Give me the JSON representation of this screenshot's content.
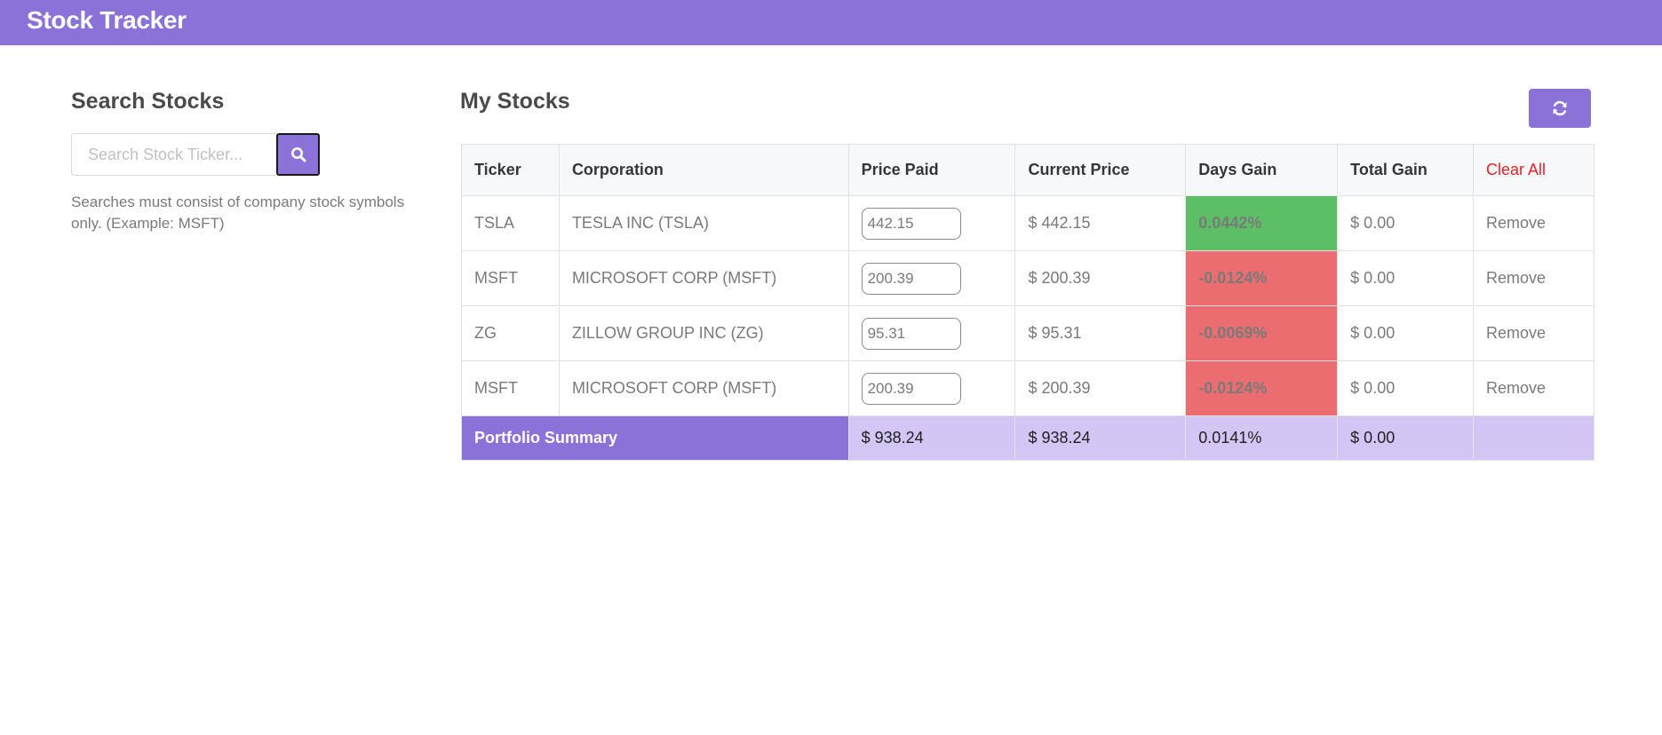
{
  "app": {
    "title": "Stock Tracker"
  },
  "search": {
    "title": "Search Stocks",
    "placeholder": "Search Stock Ticker...",
    "help": "Searches must consist of company stock symbols only. (Example: MSFT)",
    "button_icon": "search-icon"
  },
  "stocks": {
    "title": "My Stocks",
    "refresh_icon": "refresh-icon",
    "headers": {
      "ticker": "Ticker",
      "corporation": "Corporation",
      "price_paid": "Price Paid",
      "current_price": "Current Price",
      "days_gain": "Days Gain",
      "total_gain": "Total Gain",
      "clear_all": "Clear All"
    },
    "rows": [
      {
        "ticker": "TSLA",
        "corporation": "TESLA INC (TSLA)",
        "price_paid": "442.15",
        "current_price": "$ 442.15",
        "days_gain": "0.0442%",
        "days_gain_status": "positive",
        "total_gain": "$ 0.00",
        "action": "Remove"
      },
      {
        "ticker": "MSFT",
        "corporation": "MICROSOFT CORP (MSFT)",
        "price_paid": "200.39",
        "current_price": "$ 200.39",
        "days_gain": "-0.0124%",
        "days_gain_status": "negative",
        "total_gain": "$ 0.00",
        "action": "Remove"
      },
      {
        "ticker": "ZG",
        "corporation": "ZILLOW GROUP INC (ZG)",
        "price_paid": "95.31",
        "current_price": "$ 95.31",
        "days_gain": "-0.0069%",
        "days_gain_status": "negative",
        "total_gain": "$ 0.00",
        "action": "Remove"
      },
      {
        "ticker": "MSFT",
        "corporation": "MICROSOFT CORP (MSFT)",
        "price_paid": "200.39",
        "current_price": "$ 200.39",
        "days_gain": "-0.0124%",
        "days_gain_status": "negative",
        "total_gain": "$ 0.00",
        "action": "Remove"
      }
    ],
    "summary": {
      "label": "Portfolio Summary",
      "price_paid": "$ 938.24",
      "current_price": "$ 938.24",
      "days_gain": "0.0141%",
      "total_gain": "$ 0.00"
    }
  },
  "colors": {
    "brand": "#8b72d9",
    "summary_bg": "#d3c6f5",
    "gain_positive": "#5cbf66",
    "gain_negative": "#ec6d6f",
    "total_gain_text": "#3db850",
    "danger_text": "#e8212b"
  }
}
